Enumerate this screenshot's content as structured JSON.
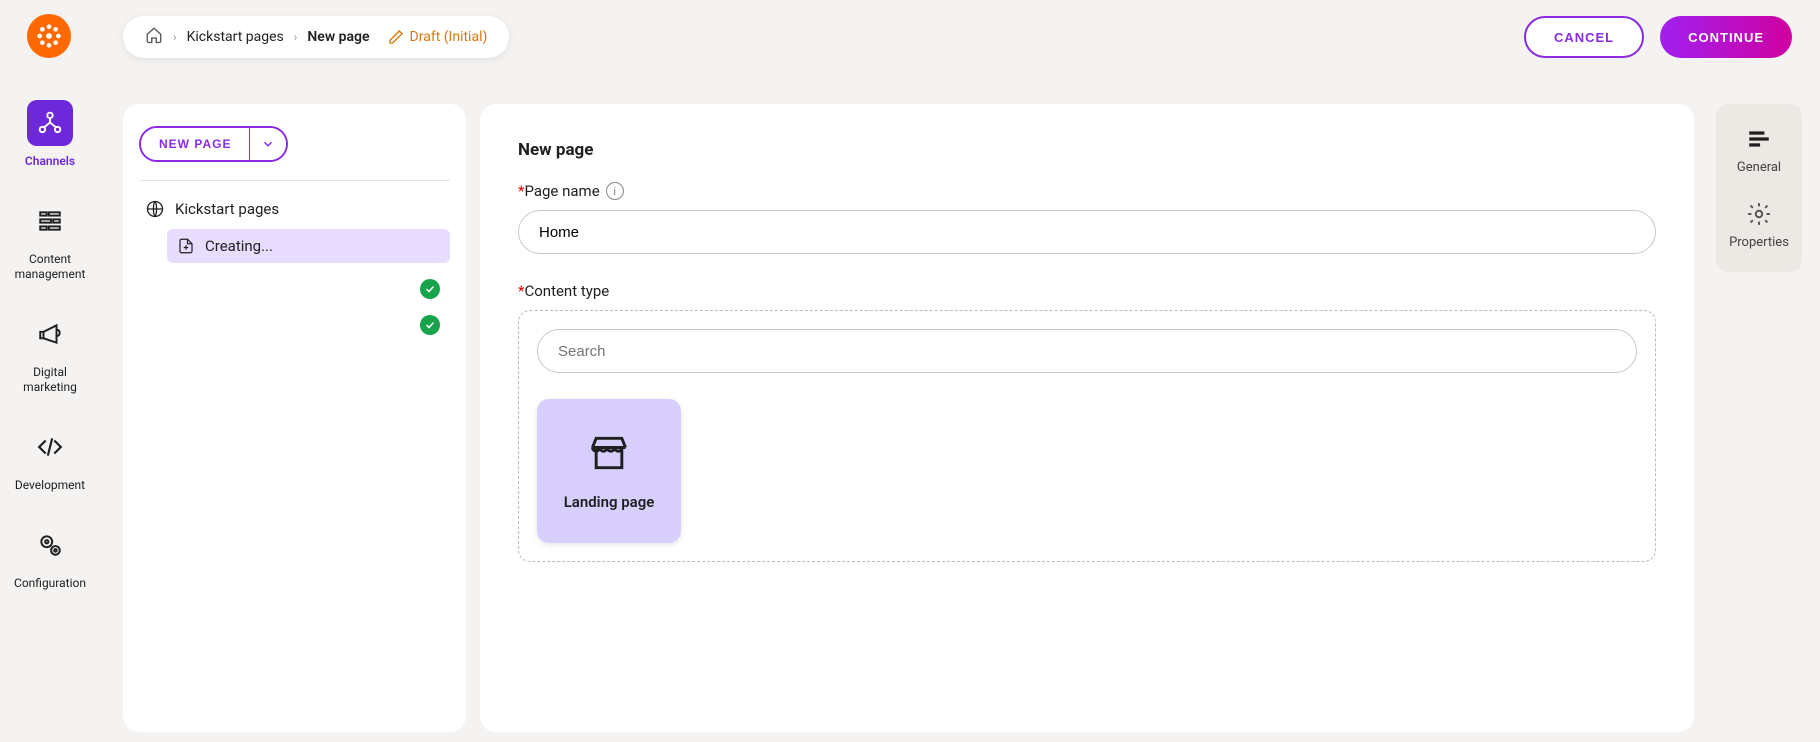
{
  "breadcrumb": {
    "root": "Kickstart pages",
    "current": "New page",
    "draft": "Draft (Initial)"
  },
  "actions": {
    "cancel": "CANCEL",
    "continue": "CONTINUE"
  },
  "leftNav": {
    "channels": "Channels",
    "content": "Content management",
    "marketing": "Digital marketing",
    "development": "Development",
    "configuration": "Configuration"
  },
  "tree": {
    "newPageBtn": "NEW PAGE",
    "root": "Kickstart pages",
    "creating": "Creating..."
  },
  "form": {
    "title": "New page",
    "pageNameLabel": "Page name",
    "pageNameValue": "Home",
    "contentTypeLabel": "Content type",
    "searchPlaceholder": "Search",
    "tileLabel": "Landing page"
  },
  "rightPanel": {
    "general": "General",
    "properties": "Properties"
  }
}
